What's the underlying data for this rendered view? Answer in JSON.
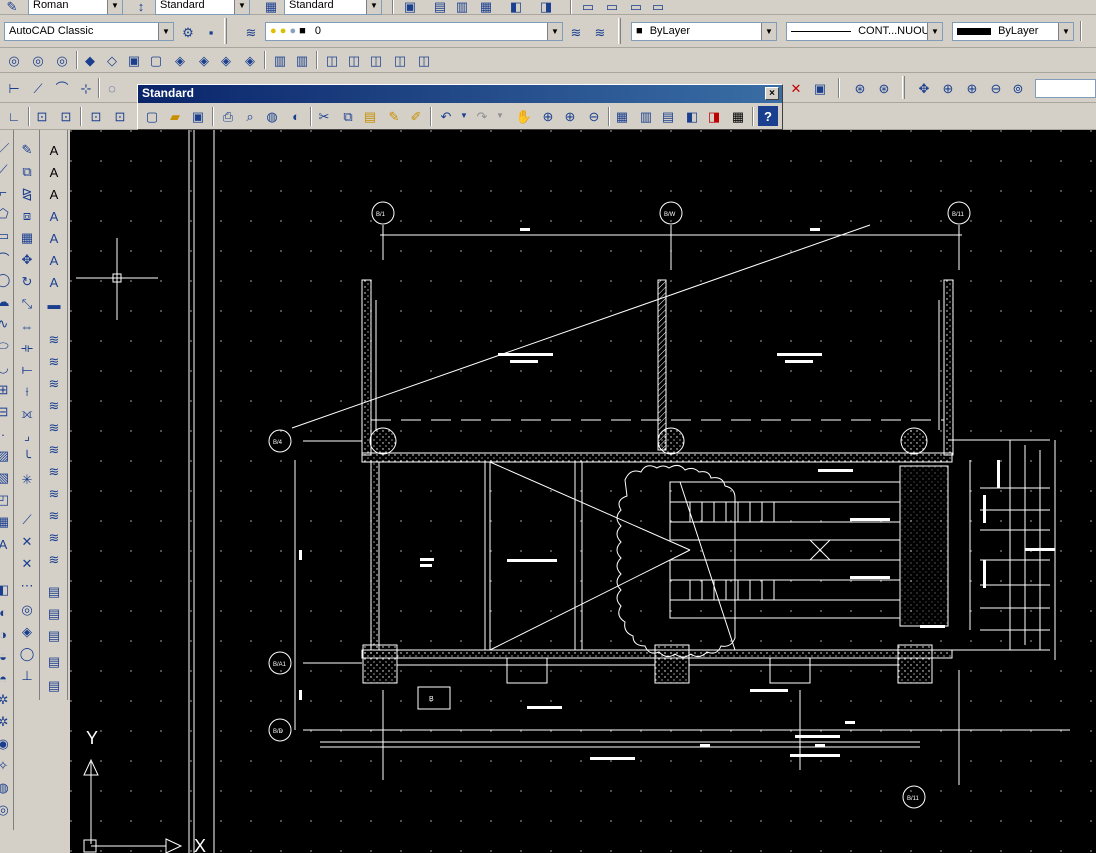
{
  "toolbar_styles": {
    "text_style": "Roman",
    "dim_style": "Standard",
    "table_style": "Standard"
  },
  "toolbar_workspace": {
    "workspace": "AutoCAD Classic",
    "layer": "0",
    "color": "ByLayer",
    "linetype": "CONT...NUOU",
    "lineweight": "ByLayer"
  },
  "float_toolbar": {
    "title": "Standard",
    "close_glyph": "×"
  },
  "ucs": {
    "y_label": "Y",
    "x_label": "X"
  },
  "drawing": {
    "grid_labels": [
      "B/1",
      "B/W",
      "B/11",
      "B/4",
      "B/A1",
      "B/D",
      "B/11"
    ],
    "small_tag": "B"
  },
  "icons": {
    "dropdown": "▼",
    "help": "?"
  },
  "colors": {
    "toolbar_bg": "#d4d0c8",
    "title_bar": "#0a246a",
    "canvas_bg": "#000000",
    "linework": "#ffffff"
  }
}
